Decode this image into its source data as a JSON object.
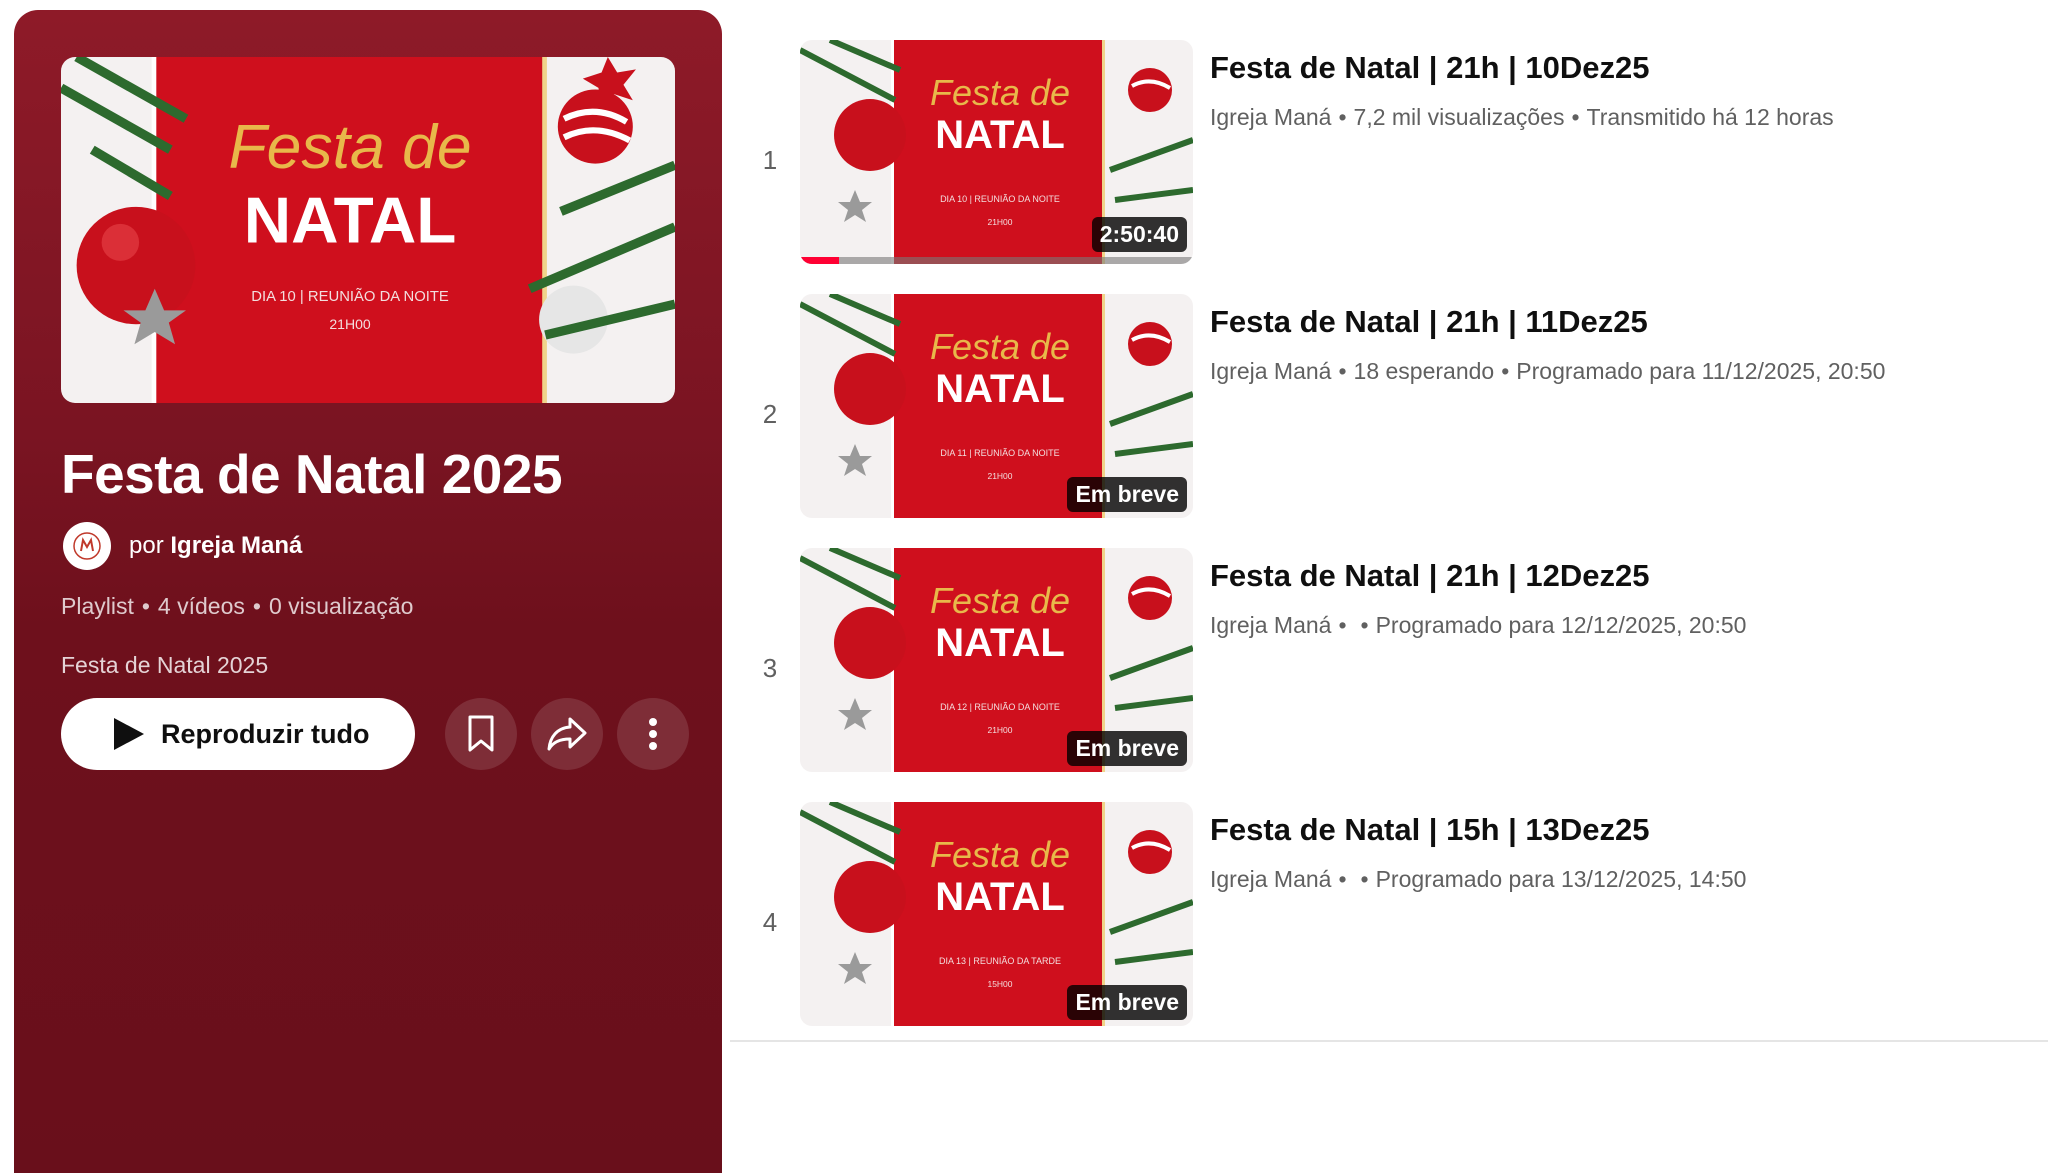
{
  "playlist": {
    "thumbnail": {
      "script_title": "Festa de",
      "big_title": "NATAL",
      "line1": "DIA 10 | REUNIÃO DA NOITE",
      "line2": "21H00"
    },
    "title": "Festa de Natal 2025",
    "owner_prefix": "por",
    "owner_name": "Igreja Maná",
    "stats": [
      "Playlist",
      "4 vídeos",
      "0 visualização"
    ],
    "description": "Festa de Natal 2025",
    "play_all_label": "Reproduzir tudo",
    "icons": {
      "play": "play-icon",
      "save": "bookmark-icon",
      "share": "share-icon",
      "more": "more-vertical-icon",
      "avatar": "church-logo-icon"
    }
  },
  "videos": [
    {
      "index": "1",
      "title": "Festa de Natal | 21h | 10Dez25",
      "channel": "Igreja Maná",
      "stat": "7,2 mil visualizações",
      "status": "Transmitido há 12 horas",
      "badge": "2:50:40",
      "watched_fraction": 0.1,
      "thumb_line1": "DIA 10 | REUNIÃO DA NOITE",
      "thumb_line2": "21H00"
    },
    {
      "index": "2",
      "title": "Festa de Natal | 21h | 11Dez25",
      "channel": "Igreja Maná",
      "stat": "18 esperando",
      "status": "Programado para 11/12/2025, 20:50",
      "badge": "Em breve",
      "thumb_line1": "DIA 11 | REUNIÃO DA NOITE",
      "thumb_line2": "21H00"
    },
    {
      "index": "3",
      "title": "Festa de Natal | 21h | 12Dez25",
      "channel": "Igreja Maná",
      "stat": "",
      "status": "Programado para 12/12/2025, 20:50",
      "badge": "Em breve",
      "thumb_line1": "DIA 12 | REUNIÃO DA NOITE",
      "thumb_line2": "21H00"
    },
    {
      "index": "4",
      "title": "Festa de Natal | 15h | 13Dez25",
      "channel": "Igreja Maná",
      "stat": "",
      "status": "Programado para 13/12/2025, 14:50",
      "badge": "Em breve",
      "thumb_line1": "DIA 13 | REUNIÃO DA TARDE",
      "thumb_line2": "15H00"
    }
  ],
  "colors": {
    "panel": "#7a1422",
    "thumb_red": "#d0101e",
    "gold": "#e8b84a",
    "progress": "#ff0033"
  }
}
